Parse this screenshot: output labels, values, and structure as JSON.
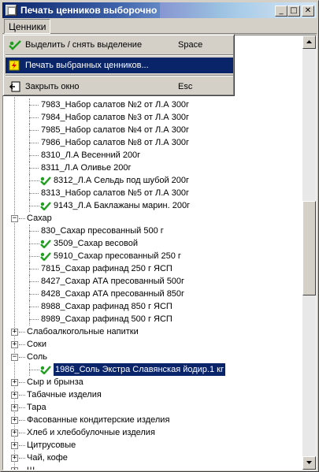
{
  "window": {
    "title": "Печать ценников выборочно",
    "minimize_glyph": "_",
    "maximize_glyph": "□",
    "close_glyph": "✕"
  },
  "menubar": {
    "items": [
      {
        "label": "Ценники"
      }
    ]
  },
  "dropdown": {
    "items": [
      {
        "label": "Выделить / снять выделение",
        "shortcut": "Space",
        "icon": "check-toggle-icon",
        "active": false
      },
      {
        "label": "Печать выбранных ценников...",
        "shortcut": "",
        "icon": "print-bolt-icon",
        "active": true
      },
      {
        "label": "Закрыть окно",
        "shortcut": "Esc",
        "icon": "close-window-icon",
        "active": false
      }
    ]
  },
  "tree": {
    "rows": [
      {
        "text": "7983_Набор салатов №2 от Л.А 300г",
        "level": 2,
        "checked": false
      },
      {
        "text": "7984_Набор салатов №3 от Л.А 300г",
        "level": 2,
        "checked": false
      },
      {
        "text": "7985_Набор салатов №4 от Л.А 300г",
        "level": 2,
        "checked": false
      },
      {
        "text": "7986_Набор салатов №8 от Л.А 300г",
        "level": 2,
        "checked": false
      },
      {
        "text": "8310_Л.А Весенний 200г",
        "level": 2,
        "checked": false
      },
      {
        "text": "8311_Л.А Оливье 200г",
        "level": 2,
        "checked": false
      },
      {
        "text": "8312_Л.А Сельдь под шубой 200г",
        "level": 2,
        "checked": true
      },
      {
        "text": "8313_Набор салатов №5 от Л.А 300г",
        "level": 2,
        "checked": false
      },
      {
        "text": "9143_Л.А Баклажаны марин. 200г",
        "level": 2,
        "checked": true
      },
      {
        "text": "Сахар",
        "level": 1,
        "expander": "−"
      },
      {
        "text": "830_Сахар пресованный 500 г",
        "level": 2,
        "checked": false
      },
      {
        "text": "3509_Сахар весовой",
        "level": 2,
        "checked": true
      },
      {
        "text": "5910_Сахар пресованный 250 г",
        "level": 2,
        "checked": true
      },
      {
        "text": "7815_Сахар рафинад 250 г ЯСП",
        "level": 2,
        "checked": false
      },
      {
        "text": "8427_Сахар АТА пресованный 500г",
        "level": 2,
        "checked": false
      },
      {
        "text": "8428_Сахар АТА пресованный 850г",
        "level": 2,
        "checked": false
      },
      {
        "text": "8988_Сахар рафинад 850 г ЯСП",
        "level": 2,
        "checked": false
      },
      {
        "text": "8989_Сахар рафинад 500 г ЯСП",
        "level": 2,
        "checked": false
      },
      {
        "text": "Слабоалкогольные напитки",
        "level": 1,
        "expander": "+"
      },
      {
        "text": "Соки",
        "level": 1,
        "expander": "+"
      },
      {
        "text": "Соль",
        "level": 1,
        "expander": "−"
      },
      {
        "text": "1986_Соль Экстра Славянская йодир.1 кг",
        "level": 2,
        "checked": true,
        "selected": true
      },
      {
        "text": "Сыр и брынза",
        "level": 1,
        "expander": "+"
      },
      {
        "text": "Табачные изделия",
        "level": 1,
        "expander": "+"
      },
      {
        "text": "Тара",
        "level": 1,
        "expander": "+"
      },
      {
        "text": "Фасованные кондитерские изделия",
        "level": 1,
        "expander": "+"
      },
      {
        "text": "Хлеб и хлебобулочные изделия",
        "level": 1,
        "expander": "+"
      },
      {
        "text": "Цитрусовые",
        "level": 1,
        "expander": "+"
      },
      {
        "text": "Чай, кофе",
        "level": 1,
        "expander": "+"
      },
      {
        "text": "Ш...",
        "level": 1,
        "expander": "+"
      }
    ]
  },
  "colors": {
    "selection": "#0a246a",
    "face": "#d4d0c8",
    "checked_leaf": "#1e9e1e"
  }
}
